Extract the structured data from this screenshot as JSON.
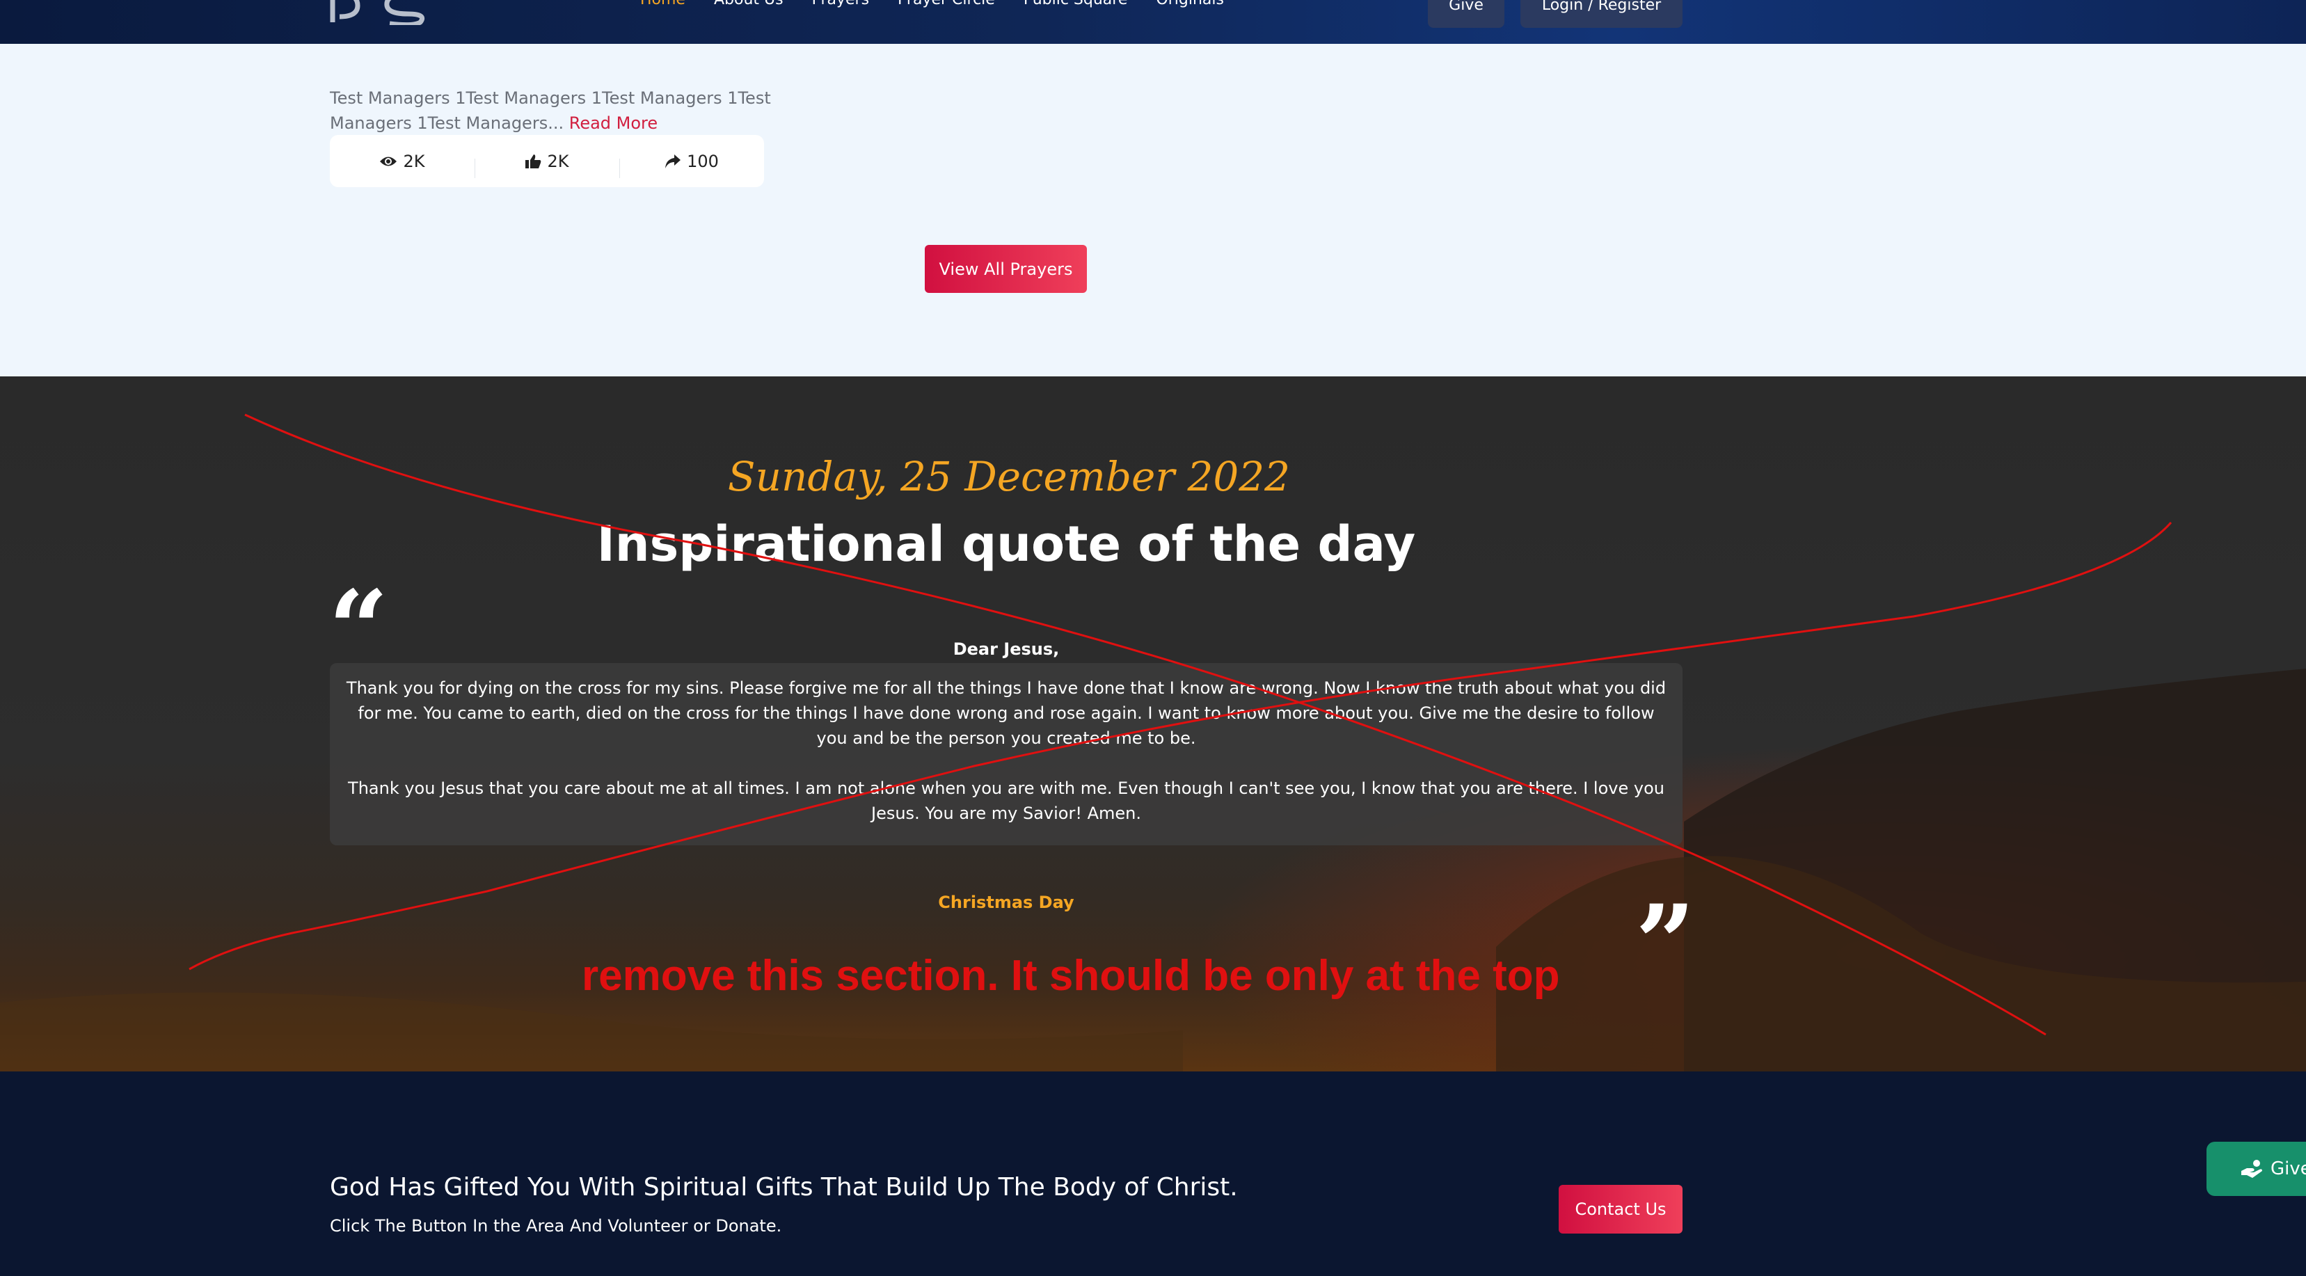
{
  "header": {
    "logo_text": "PS",
    "nav": [
      "Home",
      "About Us",
      "Prayers",
      "Prayer Circle",
      "Public Square",
      "Originals"
    ],
    "give_label": "Give",
    "login_label": "Login / Register",
    "colors": {
      "active": "#f5a623"
    }
  },
  "prayer_card": {
    "excerpt": "Test Managers 1Test Managers 1Test Managers 1Test Managers 1Test Managers...",
    "read_more": "Read More",
    "views": "2K",
    "likes": "2K",
    "shares": "100"
  },
  "view_all_label": "View All Prayers",
  "quote": {
    "date": "Sunday, 25 December 2022",
    "title": "Inspirational quote of the day",
    "salutation": "Dear Jesus,",
    "paragraph1": "Thank you for dying on the cross for my sins. Please forgive me for all the things I have done that I know are wrong. Now I know the truth about what you did for me. You came to earth, died on the cross for the things I have done wrong and rose again. I want to know more about you. Give me the desire to follow you and be the person you created me to be.",
    "paragraph2": "Thank you Jesus that you care about me at all times. I am not alone when you are with me. Even though I can't see you, I know that you are there. I love you Jesus. You are my Savior! Amen.",
    "occasion": "Christmas Day",
    "annotation": "remove this section. It should be only at the top"
  },
  "cta": {
    "title": "God Has Gifted You With Spiritual Gifts That Build Up The Body of Christ.",
    "subtitle": "Click The Button In the Area And Volunteer or Donate.",
    "contact_label": "Contact Us",
    "give_float_label": "Give"
  }
}
